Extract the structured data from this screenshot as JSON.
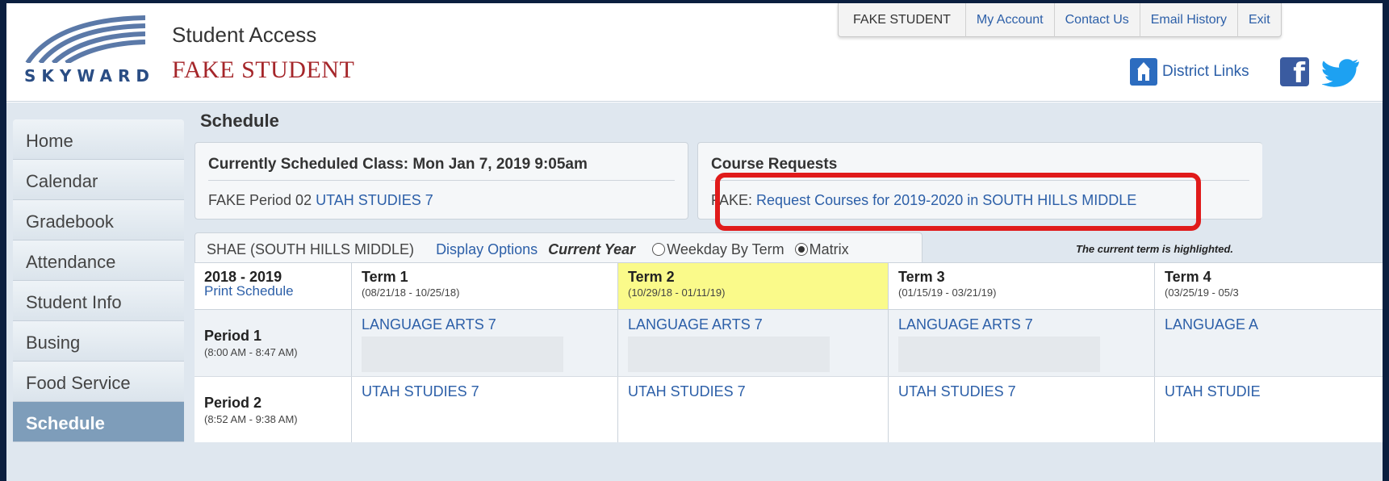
{
  "app": {
    "logo_text": "SKYWARD",
    "title": "Student Access",
    "student_name": "FAKE STUDENT"
  },
  "topnav": {
    "user": "FAKE STUDENT",
    "my_account": "My Account",
    "contact_us": "Contact Us",
    "email_history": "Email History",
    "exit": "Exit"
  },
  "links": {
    "district_links": "District Links"
  },
  "sidebar": {
    "items": [
      {
        "label": "Home"
      },
      {
        "label": "Calendar"
      },
      {
        "label": "Gradebook"
      },
      {
        "label": "Attendance"
      },
      {
        "label": "Student Info"
      },
      {
        "label": "Busing"
      },
      {
        "label": "Food Service"
      },
      {
        "label": "Schedule"
      }
    ],
    "active": "Schedule"
  },
  "page": {
    "title": "Schedule"
  },
  "current_class": {
    "heading": "Currently Scheduled Class: Mon Jan 7, 2019 9:05am",
    "prefix": "FAKE Period 02",
    "course": "UTAH STUDIES 7"
  },
  "course_requests": {
    "heading": "Course Requests",
    "prefix": "FAKE:",
    "link": "Request Courses for 2019-2020 in SOUTH HILLS MIDDLE"
  },
  "schedule": {
    "school": "SHAE  (SOUTH HILLS MIDDLE)",
    "display_options": "Display Options",
    "current_year": "Current Year",
    "view_weekday": "Weekday By Term",
    "view_matrix": "Matrix",
    "selected_view": "Matrix",
    "term_note": "The current term is highlighted.",
    "year": "2018 - 2019",
    "print": "Print Schedule",
    "terms": [
      {
        "name": "Term 1",
        "dates": "(08/21/18 - 10/25/18)"
      },
      {
        "name": "Term 2",
        "dates": "(10/29/18 - 01/11/19)"
      },
      {
        "name": "Term 3",
        "dates": "(01/15/19 - 03/21/19)"
      },
      {
        "name": "Term 4",
        "dates": "(03/25/19 - 05/3"
      }
    ],
    "current_term": "Term 2",
    "periods": [
      {
        "name": "Period 1",
        "time": "(8:00 AM - 8:47 AM)",
        "courses": [
          "LANGUAGE ARTS 7",
          "LANGUAGE ARTS 7",
          "LANGUAGE ARTS 7",
          "LANGUAGE A"
        ]
      },
      {
        "name": "Period 2",
        "time": "(8:52 AM - 9:38 AM)",
        "courses": [
          "UTAH STUDIES 7",
          "UTAH STUDIES 7",
          "UTAH STUDIES 7",
          "UTAH STUDIE"
        ]
      }
    ]
  },
  "colors": {
    "brand": "#2a4d84",
    "link": "#2c5fa8",
    "student_name": "#a5262a",
    "current_term": "#fafa8a",
    "annotation": "#e01b1b",
    "active_nav": "#7e9dba"
  }
}
